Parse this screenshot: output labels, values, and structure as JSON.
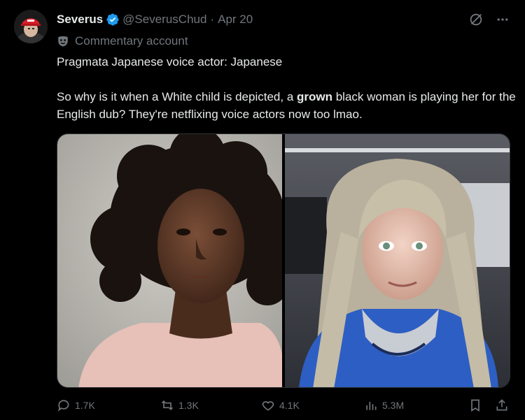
{
  "author": {
    "name": "Severus",
    "handle": "@SeverusChud",
    "date": "Apr 20",
    "label": "Commentary account"
  },
  "tweet": {
    "line1": "Pragmata Japanese voice actor: Japanese",
    "line2_before": "So why is it when a White child is depicted, a ",
    "line2_bold": "grown",
    "line2_after": " black woman is playing her for the English dub? They're netflixing voice actors now too lmao."
  },
  "metrics": {
    "replies": "1.7K",
    "reposts": "1.3K",
    "likes": "4.1K",
    "views": "5.3M"
  },
  "colors": {
    "background": "#000000",
    "text": "#e7e9ea",
    "muted": "#71767b",
    "verified": "#1d9bf0"
  }
}
